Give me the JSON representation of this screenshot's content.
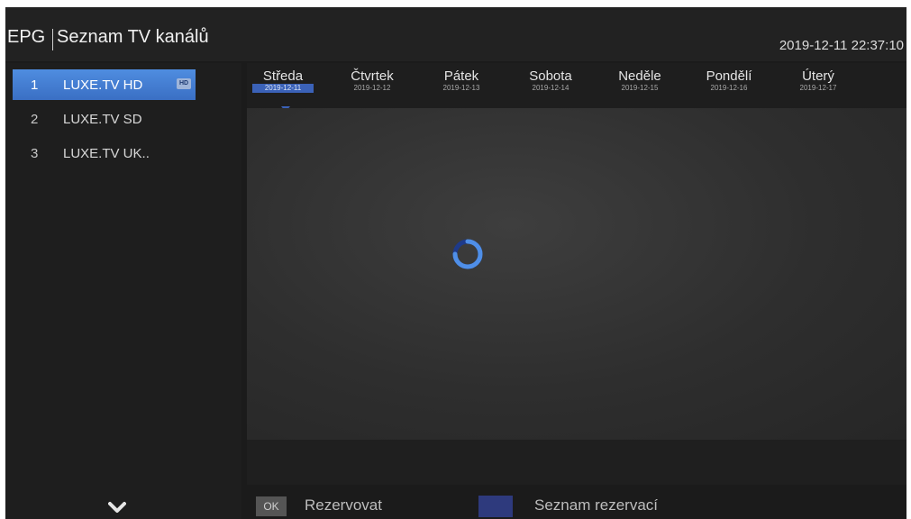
{
  "header": {
    "epg_label": "EPG",
    "title": "Seznam TV kanálů",
    "datetime": "2019-12-11 22:37:10"
  },
  "channels": [
    {
      "number": "1",
      "name": "LUXE.TV HD",
      "badge": "HD",
      "selected": true
    },
    {
      "number": "2",
      "name": "LUXE.TV SD"
    },
    {
      "number": "3",
      "name": "LUXE.TV UK.."
    }
  ],
  "days": [
    {
      "name": "Středa",
      "date": "2019-12-11",
      "selected": true
    },
    {
      "name": "Čtvrtek",
      "date": "2019-12-12"
    },
    {
      "name": "Pátek",
      "date": "2019-12-13"
    },
    {
      "name": "Sobota",
      "date": "2019-12-14"
    },
    {
      "name": "Neděle",
      "date": "2019-12-15"
    },
    {
      "name": "Pondělí",
      "date": "2019-12-16"
    },
    {
      "name": "Úterý",
      "date": "2019-12-17"
    }
  ],
  "footer": {
    "ok_key": "OK",
    "reserve_label": "Rezervovat",
    "reservations_label": "Seznam rezervací"
  },
  "icons": {
    "scroll": "chevron-down-icon",
    "loading": "loading-spinner-icon"
  },
  "colors": {
    "accent": "#3b62b8",
    "selection": "#4f8de0",
    "blue_key": "#2e3a7d"
  }
}
